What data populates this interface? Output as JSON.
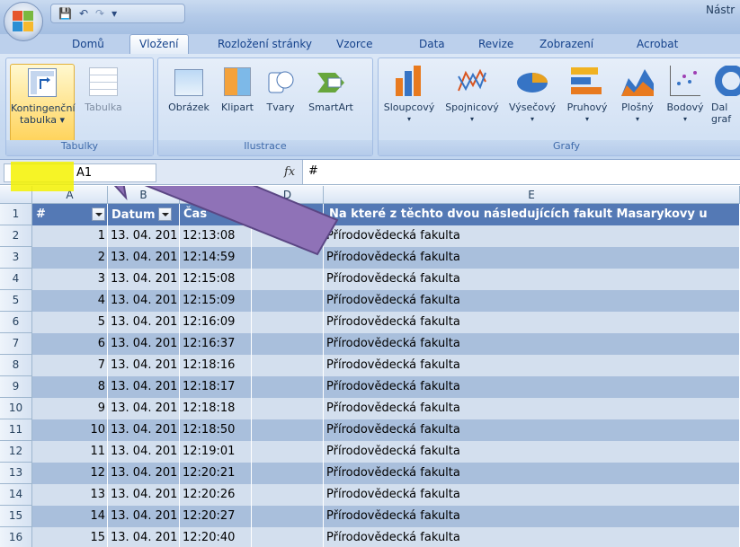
{
  "window": {
    "title_partial": "Nástr",
    "qat": [
      "💾",
      "↶",
      "↷",
      "▾"
    ]
  },
  "tabs": [
    "Domů",
    "Vložení",
    "Rozložení stránky",
    "Vzorce",
    "Data",
    "Revize",
    "Zobrazení",
    "Acrobat"
  ],
  "active_tab": "Vložení",
  "ribbon": {
    "groups": {
      "tables": {
        "label": "Tabulky",
        "buttons": {
          "pivot_line1": "Kontingenční",
          "pivot_line2": "tabulka ▾",
          "table": "Tabulka"
        }
      },
      "illustrations": {
        "label": "Ilustrace",
        "buttons": {
          "picture": "Obrázek",
          "clipart": "Klipart",
          "shapes_line1": "Tvary",
          "smartart": "SmartArt"
        }
      },
      "charts": {
        "label": "Grafy",
        "buttons": {
          "column": "Sloupcový",
          "line": "Spojnicový",
          "pie": "Výsečový",
          "bar": "Pruhový",
          "area": "Plošný",
          "scatter": "Bodový",
          "other_line1": "Dal",
          "other_line2": "graf"
        }
      }
    }
  },
  "formula_bar": {
    "cell_ref": "A1",
    "fx": "fx",
    "value": "#"
  },
  "columns": [
    "A",
    "B",
    "C",
    "D",
    "E"
  ],
  "header_row": {
    "col_a": "#",
    "col_b": "Datum",
    "col_c": "Čas",
    "col_e": "Na které z těchto dvou následujících fakult Masarykovy u"
  },
  "rows": [
    {
      "row": "2",
      "num": "1",
      "date": "13. 04. 201",
      "time": "12:13:08",
      "faculty": "Přírodovědecká fakulta"
    },
    {
      "row": "3",
      "num": "2",
      "date": "13. 04. 201",
      "time": "12:14:59",
      "faculty": "Přírodovědecká fakulta"
    },
    {
      "row": "4",
      "num": "3",
      "date": "13. 04. 201",
      "time": "12:15:08",
      "faculty": "Přírodovědecká fakulta"
    },
    {
      "row": "5",
      "num": "4",
      "date": "13. 04. 201",
      "time": "12:15:09",
      "faculty": "Přírodovědecká fakulta"
    },
    {
      "row": "6",
      "num": "5",
      "date": "13. 04. 201",
      "time": "12:16:09",
      "faculty": "Přírodovědecká fakulta"
    },
    {
      "row": "7",
      "num": "6",
      "date": "13. 04. 201",
      "time": "12:16:37",
      "faculty": "Přírodovědecká fakulta"
    },
    {
      "row": "8",
      "num": "7",
      "date": "13. 04. 201",
      "time": "12:18:16",
      "faculty": "Přírodovědecká fakulta"
    },
    {
      "row": "9",
      "num": "8",
      "date": "13. 04. 201",
      "time": "12:18:17",
      "faculty": "Přírodovědecká fakulta"
    },
    {
      "row": "10",
      "num": "9",
      "date": "13. 04. 201",
      "time": "12:18:18",
      "faculty": "Přírodovědecká fakulta"
    },
    {
      "row": "11",
      "num": "10",
      "date": "13. 04. 201",
      "time": "12:18:50",
      "faculty": "Přírodovědecká fakulta"
    },
    {
      "row": "12",
      "num": "11",
      "date": "13. 04. 201",
      "time": "12:19:01",
      "faculty": "Přírodovědecká fakulta"
    },
    {
      "row": "13",
      "num": "12",
      "date": "13. 04. 201",
      "time": "12:20:21",
      "faculty": "Přírodovědecká fakulta"
    },
    {
      "row": "14",
      "num": "13",
      "date": "13. 04. 201",
      "time": "12:20:26",
      "faculty": "Přírodovědecká fakulta"
    },
    {
      "row": "15",
      "num": "14",
      "date": "13. 04. 201",
      "time": "12:20:27",
      "faculty": "Přírodovědecká fakulta"
    },
    {
      "row": "16",
      "num": "15",
      "date": "13. 04. 201",
      "time": "12:20:40",
      "faculty": "Přírodovědecká fakulta"
    }
  ],
  "colors": {
    "arrow": "#8f72b7",
    "highlight": "#f5f200",
    "header_fill": "#5479b5",
    "band_dark": "#a9bfdc",
    "band_light": "#d3dfee"
  }
}
